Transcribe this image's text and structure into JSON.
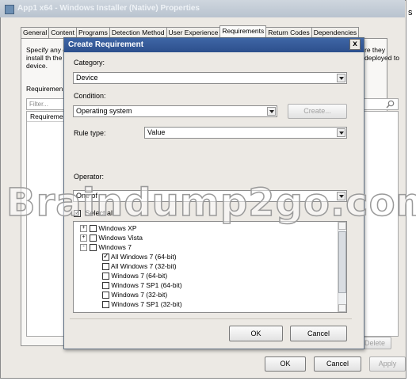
{
  "outer_window": {
    "title": "App1 x64 - Windows Installer (Native) Properties",
    "clipped_char": "s",
    "tabs": [
      "General",
      "Content",
      "Programs",
      "Detection Method",
      "User Experience",
      "Requirements",
      "Return Codes",
      "Dependencies"
    ],
    "active_tab": "Requirements",
    "description_left": "Specify any can install th the device.",
    "description_right": "re they deployed to",
    "requirements_label": "Requiremen",
    "filter_placeholder": "Filter...",
    "list_header": "Requireme",
    "delete_label": "Delete",
    "ok_label": "OK",
    "cancel_label": "Cancel",
    "apply_label": "Apply"
  },
  "dialog": {
    "title": "Create Requirement",
    "close_label": "x",
    "category_label": "Category:",
    "category_value": "Device",
    "condition_label": "Condition:",
    "condition_value": "Operating system",
    "create_label": "Create...",
    "rule_type_label": "Rule type:",
    "rule_type_value": "Value",
    "operator_label": "Operator:",
    "operator_value": "One of",
    "select_all_label": "Select all",
    "select_all_checked": true,
    "tree": [
      {
        "label": "Windows XP",
        "expander": "+",
        "indent": 0,
        "checked": false
      },
      {
        "label": "Windows Vista",
        "expander": "+",
        "indent": 0,
        "checked": false
      },
      {
        "label": "Windows 7",
        "expander": "-",
        "indent": 0,
        "checked": false
      },
      {
        "label": "All Windows 7 (64-bit)",
        "expander": "",
        "indent": 1,
        "checked": true
      },
      {
        "label": "All Windows 7 (32-bit)",
        "expander": "",
        "indent": 1,
        "checked": false
      },
      {
        "label": "Windows 7 (64-bit)",
        "expander": "",
        "indent": 1,
        "checked": false
      },
      {
        "label": "Windows 7 SP1 (64-bit)",
        "expander": "",
        "indent": 1,
        "checked": false
      },
      {
        "label": "Windows 7 (32-bit)",
        "expander": "",
        "indent": 1,
        "checked": false
      },
      {
        "label": "Windows 7 SP1 (32-bit)",
        "expander": "",
        "indent": 1,
        "checked": false
      }
    ],
    "ok_label": "OK",
    "cancel_label": "Cancel"
  },
  "watermark": "Braindump2go.com",
  "colors": {
    "dialog_title_bar": "#2c4f8c",
    "window_bg": "#ece9e4",
    "outer_title_bar": "#b9c3cf"
  }
}
